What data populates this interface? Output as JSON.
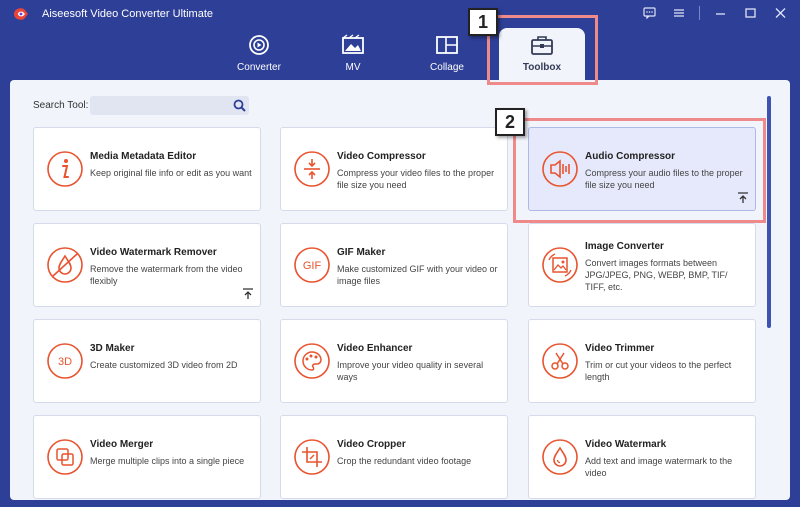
{
  "app": {
    "title": "Aiseesoft Video Converter Ultimate"
  },
  "nav": {
    "tabs": [
      {
        "label": "Converter",
        "icon": "converter-icon"
      },
      {
        "label": "MV",
        "icon": "mv-icon"
      },
      {
        "label": "Collage",
        "icon": "collage-icon"
      },
      {
        "label": "Toolbox",
        "icon": "toolbox-icon",
        "active": true
      }
    ]
  },
  "search": {
    "label": "Search Tool:",
    "value": "",
    "placeholder": ""
  },
  "tools": [
    {
      "title": "Media Metadata Editor",
      "desc": "Keep original file info or edit as you want",
      "icon": "info-icon"
    },
    {
      "title": "Video Compressor",
      "desc": "Compress your video files to the proper file size you need",
      "icon": "compress-icon"
    },
    {
      "title": "Audio Compressor",
      "desc": "Compress your audio files to the proper file size you need",
      "icon": "audio-compress-icon",
      "active": true
    },
    {
      "title": "Video Watermark Remover",
      "desc": "Remove the watermark from the video flexibly",
      "icon": "watermark-remove-icon"
    },
    {
      "title": "GIF Maker",
      "desc": "Make customized GIF with your video or image files",
      "icon": "gif-icon"
    },
    {
      "title": "Image Converter",
      "desc": "Convert images formats between JPG/JPEG, PNG, WEBP, BMP, TIF/ TIFF, etc.",
      "icon": "image-convert-icon"
    },
    {
      "title": "3D Maker",
      "desc": "Create customized 3D video from 2D",
      "icon": "3d-icon"
    },
    {
      "title": "Video Enhancer",
      "desc": "Improve your video quality in several ways",
      "icon": "palette-icon"
    },
    {
      "title": "Video Trimmer",
      "desc": "Trim or cut your videos to the perfect length",
      "icon": "scissors-icon"
    },
    {
      "title": "Video Merger",
      "desc": "Merge multiple clips into a single piece",
      "icon": "merge-icon"
    },
    {
      "title": "Video Cropper",
      "desc": "Crop the redundant video footage",
      "icon": "crop-icon"
    },
    {
      "title": "Video Watermark",
      "desc": "Add text and image watermark to the video",
      "icon": "watermark-icon"
    }
  ],
  "annotations": {
    "step1": "1",
    "step2": "2"
  },
  "colors": {
    "accent": "#e8542f",
    "brand": "#2e3f97",
    "highlight": "#ee8a8a"
  }
}
